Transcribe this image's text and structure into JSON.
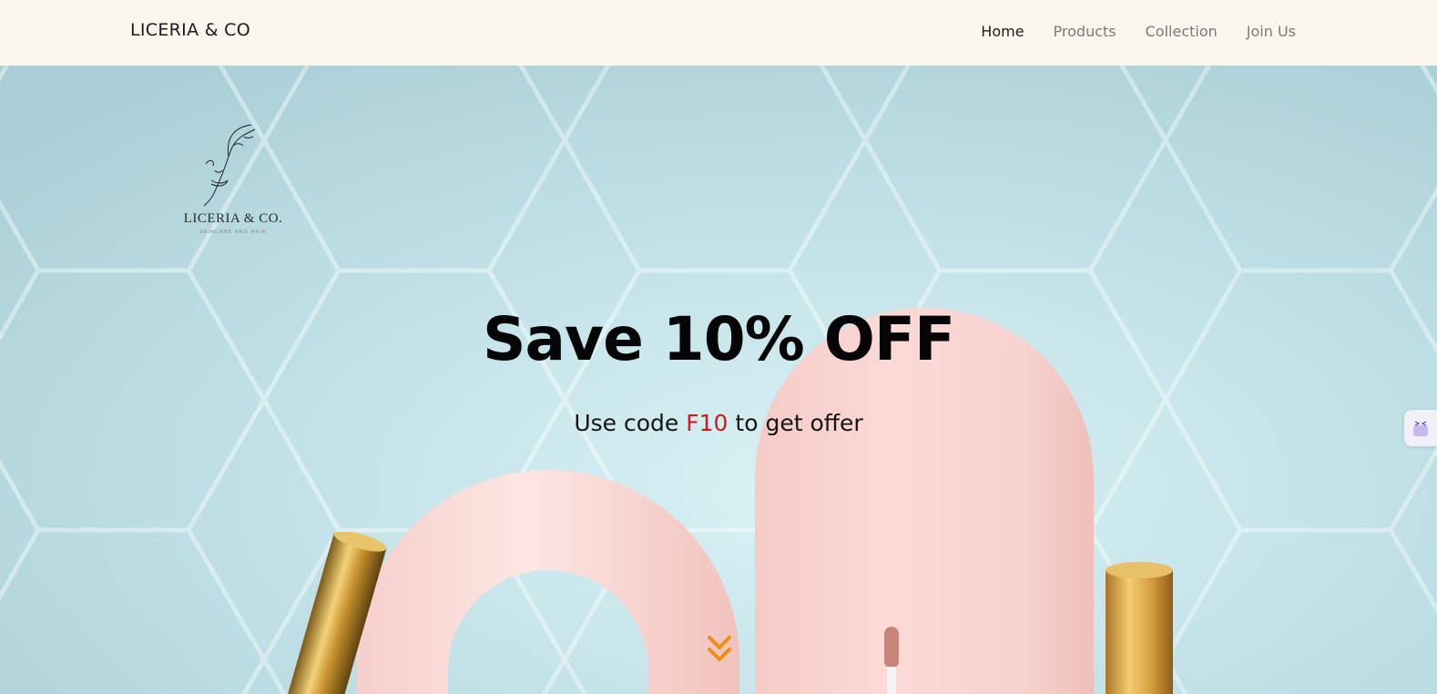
{
  "navbar": {
    "brand": "LICERIA & CO",
    "links": [
      {
        "label": "Home",
        "active": true
      },
      {
        "label": "Products",
        "active": false
      },
      {
        "label": "Collection",
        "active": false
      },
      {
        "label": "Join Us",
        "active": false
      }
    ]
  },
  "hero": {
    "logo_name": "LICERIA & CO.",
    "logo_tagline": "SKINCARE AND HAIR",
    "headline": "Save 10% OFF",
    "subline_before": "Use code ",
    "promo_code": "F10",
    "subline_after": " to get offer",
    "scroll_icon": "double-chevron-down-icon"
  },
  "side_widget": {
    "icon": "chat-bot-icon"
  },
  "colors": {
    "navbar_bg": "#faf6ee",
    "promo_code": "#d31a1a",
    "scroll_arrow": "#f08c12",
    "arch_pink": "#f8d2ce"
  }
}
